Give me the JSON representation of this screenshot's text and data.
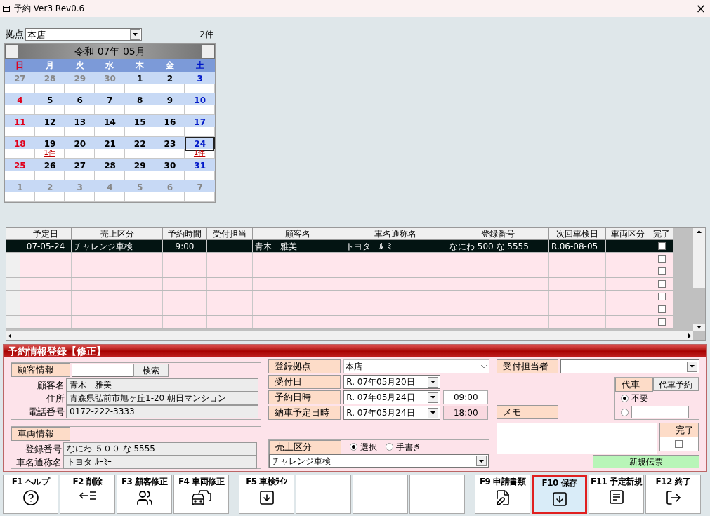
{
  "window": {
    "title": "予約 Ver3 Rev0.6",
    "close": "×"
  },
  "branch": {
    "label": "拠点",
    "value": "本店"
  },
  "count": "2件",
  "calendar": {
    "title": "令和 07年 05月",
    "weekdays": [
      {
        "label": "日",
        "kind": "sun"
      },
      {
        "label": "月",
        "kind": "weekday"
      },
      {
        "label": "火",
        "kind": "weekday"
      },
      {
        "label": "水",
        "kind": "weekday"
      },
      {
        "label": "木",
        "kind": "weekday"
      },
      {
        "label": "金",
        "kind": "weekday"
      },
      {
        "label": "土",
        "kind": "sat"
      }
    ],
    "weeks": [
      [
        {
          "day": "27",
          "kind": "other",
          "selected": false
        },
        {
          "day": "28",
          "kind": "other",
          "selected": false
        },
        {
          "day": "29",
          "kind": "other",
          "selected": false
        },
        {
          "day": "30",
          "kind": "other",
          "selected": false
        },
        {
          "day": "1",
          "kind": "weekday",
          "selected": false
        },
        {
          "day": "2",
          "kind": "weekday",
          "selected": false
        },
        {
          "day": "3",
          "kind": "sat",
          "selected": false
        }
      ],
      [
        {
          "day": "4",
          "kind": "sun",
          "selected": false
        },
        {
          "day": "5",
          "kind": "weekday",
          "selected": false
        },
        {
          "day": "6",
          "kind": "weekday",
          "selected": false
        },
        {
          "day": "7",
          "kind": "weekday",
          "selected": false
        },
        {
          "day": "8",
          "kind": "weekday",
          "selected": false
        },
        {
          "day": "9",
          "kind": "weekday",
          "selected": false
        },
        {
          "day": "10",
          "kind": "sat",
          "selected": false
        }
      ],
      [
        {
          "day": "11",
          "kind": "sun",
          "selected": false
        },
        {
          "day": "12",
          "kind": "weekday",
          "selected": false
        },
        {
          "day": "13",
          "kind": "weekday",
          "selected": false
        },
        {
          "day": "14",
          "kind": "weekday",
          "selected": false
        },
        {
          "day": "15",
          "kind": "weekday",
          "selected": false
        },
        {
          "day": "16",
          "kind": "weekday",
          "selected": false
        },
        {
          "day": "17",
          "kind": "sat",
          "selected": false
        }
      ],
      [
        {
          "day": "18",
          "kind": "sun",
          "selected": false
        },
        {
          "day": "19",
          "kind": "weekday",
          "selected": false,
          "count": "1件"
        },
        {
          "day": "20",
          "kind": "weekday",
          "selected": false
        },
        {
          "day": "21",
          "kind": "weekday",
          "selected": false
        },
        {
          "day": "22",
          "kind": "weekday",
          "selected": false
        },
        {
          "day": "23",
          "kind": "weekday",
          "selected": false
        },
        {
          "day": "24",
          "kind": "sat",
          "selected": true,
          "count": "1件"
        }
      ],
      [
        {
          "day": "25",
          "kind": "sun",
          "selected": false
        },
        {
          "day": "26",
          "kind": "weekday",
          "selected": false
        },
        {
          "day": "27",
          "kind": "weekday",
          "selected": false
        },
        {
          "day": "28",
          "kind": "weekday",
          "selected": false
        },
        {
          "day": "29",
          "kind": "weekday",
          "selected": false
        },
        {
          "day": "30",
          "kind": "weekday",
          "selected": false
        },
        {
          "day": "31",
          "kind": "sat",
          "selected": false
        }
      ],
      [
        {
          "day": "1",
          "kind": "other",
          "selected": false
        },
        {
          "day": "2",
          "kind": "other",
          "selected": false
        },
        {
          "day": "3",
          "kind": "other",
          "selected": false
        },
        {
          "day": "4",
          "kind": "other",
          "selected": false
        },
        {
          "day": "5",
          "kind": "other",
          "selected": false
        },
        {
          "day": "6",
          "kind": "other",
          "selected": false
        },
        {
          "day": "7",
          "kind": "other",
          "selected": false
        }
      ]
    ]
  },
  "table": {
    "columns": [
      "予定日",
      "売上区分",
      "予約時間",
      "受付担当",
      "顧客名",
      "車名通称名",
      "登録番号",
      "次回車検日",
      "車両区分",
      "完了"
    ],
    "rows": [
      {
        "selected": true,
        "done": false,
        "cells": [
          "07-05-24",
          "チャレンジ車検",
          "9:00",
          "",
          "青木　雅美",
          "トヨタ　ﾙｰﾐｰ",
          "なにわ 500 な 5555",
          "R.06-08-05",
          ""
        ]
      },
      {
        "selected": false,
        "done": false
      },
      {
        "selected": false,
        "done": false
      },
      {
        "selected": false,
        "done": false
      },
      {
        "selected": false,
        "done": false
      },
      {
        "selected": false,
        "done": false
      },
      {
        "selected": false,
        "done": false
      }
    ]
  },
  "form": {
    "title": "予約情報登録【修正】",
    "customer": {
      "header": "顧客情報",
      "search_button": "検索",
      "rows": [
        {
          "label": "顧客名",
          "value": "青木　雅美"
        },
        {
          "label": "住所",
          "value": "青森県弘前市旭ヶ丘1-20 朝日マンション"
        },
        {
          "label": "電話番号",
          "value": "0172-222-3333"
        }
      ]
    },
    "vehicle": {
      "header": "車両情報",
      "rows": [
        {
          "label": "登録番号",
          "value": "なにわ ５００ な 5555"
        },
        {
          "label": "車名通称名",
          "value": "トヨタ ﾙｰﾐｰ"
        }
      ]
    },
    "reg_branch": {
      "label": "登録拠点",
      "value": "本店"
    },
    "received": {
      "label": "受付日",
      "date": "R. 07年05月20日"
    },
    "reservation": {
      "label": "予約日時",
      "date": "R. 07年05月24日",
      "time": "09:00"
    },
    "delivery": {
      "label": "納車予定日時",
      "date": "R. 07年05月24日",
      "time": "18:00"
    },
    "sales": {
      "label": "売上区分",
      "options": [
        {
          "label": "選択",
          "selected": true
        },
        {
          "label": "手書き",
          "selected": false
        }
      ],
      "value": "チャレンジ車検"
    },
    "staff": {
      "label": "受付担当者"
    },
    "loaner": {
      "label": "代車",
      "button": "代車予約",
      "options": [
        {
          "kind": "text",
          "label": "不要",
          "selected": true
        },
        {
          "kind": "input",
          "selected": false
        }
      ]
    },
    "memo": {
      "label": "メモ"
    },
    "done": {
      "label": "完了",
      "checked": false
    },
    "new_slip": "新規伝票"
  },
  "function_keys": [
    {
      "label": "F1 ヘルプ",
      "kind": "help",
      "selected": false
    },
    {
      "label": "F2 削除",
      "kind": "delete",
      "selected": false
    },
    {
      "label": "F3 顧客修正",
      "kind": "customer",
      "selected": false
    },
    {
      "label": "F4 車両修正",
      "kind": "vehicle",
      "selected": false
    },
    {
      "label": "F5 車検ﾗｲﾝ",
      "kind": "save",
      "selected": false
    },
    {
      "kind": "empty",
      "selected": false
    },
    {
      "kind": "empty",
      "selected": false
    },
    {
      "kind": "empty",
      "selected": false
    },
    {
      "label": "F9 申請書類",
      "kind": "document",
      "selected": false
    },
    {
      "label": "F10 保存",
      "kind": "save",
      "selected": true
    },
    {
      "label": "F11 予定新規",
      "kind": "list",
      "selected": false
    },
    {
      "label": "F12 終了",
      "kind": "exit",
      "selected": false
    }
  ]
}
